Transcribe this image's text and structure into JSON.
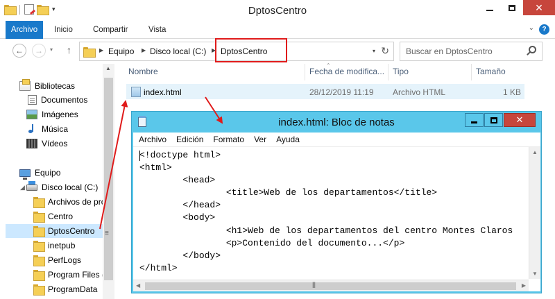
{
  "explorer": {
    "title": "DptosCentro",
    "ribbon_tabs": [
      "Archivo",
      "Inicio",
      "Compartir",
      "Vista"
    ],
    "help_label": "?",
    "address": {
      "crumbs": [
        "Equipo",
        "Disco local (C:)",
        "DptosCentro"
      ]
    },
    "search_placeholder": "Buscar en DptosCentro",
    "nav_pane": {
      "libraries": {
        "label": "Bibliotecas",
        "items": [
          "Documentos",
          "Imágenes",
          "Música",
          "Vídeos"
        ]
      },
      "computer": {
        "label": "Equipo",
        "drive": "Disco local (C:)",
        "folders": [
          "Archivos de pro",
          "Centro",
          "DptosCentro",
          "inetpub",
          "PerfLogs",
          "Program Files (",
          "ProgramData"
        ]
      },
      "selected": "DptosCentro"
    },
    "columns": [
      "Nombre",
      "Fecha de modifica...",
      "Tipo",
      "Tamaño"
    ],
    "files": [
      {
        "name": "index.html",
        "modified": "28/12/2019 11:19",
        "type": "Archivo HTML",
        "size": "1 KB"
      }
    ]
  },
  "notepad": {
    "title": "index.html: Bloc de notas",
    "menu": [
      "Archivo",
      "Edición",
      "Formato",
      "Ver",
      "Ayuda"
    ],
    "content": "<!doctype html>\n<html>\n        <head>\n                <title>Web de los departamentos</title>\n        </head>\n        <body>\n                <h1>Web de los departamentos del centro Montes Claros\n                <p>Contenido del documento...</p>\n        </body>\n</html>"
  },
  "colors": {
    "accent": "#1979ca",
    "notepad_frame": "#5ac7ea",
    "annotation": "#e01b1b",
    "close": "#c7463c",
    "selection": "#cce8ff"
  }
}
